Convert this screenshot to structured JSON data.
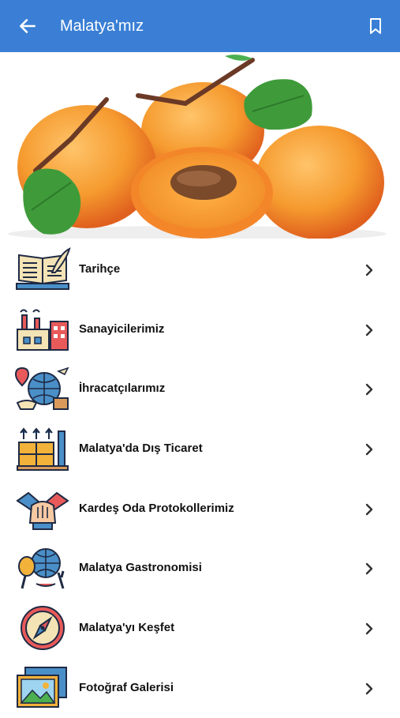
{
  "appbar": {
    "title": "Malatya'mız",
    "back_icon": "arrow-left-icon",
    "bookmark_icon": "bookmark-icon"
  },
  "hero": {
    "image": "apricots-photo"
  },
  "menu": [
    {
      "label": "Tarihçe",
      "icon": "history-book-icon"
    },
    {
      "label": "Sanayicilerimiz",
      "icon": "factory-icon"
    },
    {
      "label": "İhracatçılarımız",
      "icon": "export-globe-icon"
    },
    {
      "label": "Malatya'da Dış Ticaret",
      "icon": "trade-boxes-icon"
    },
    {
      "label": "Kardeş Oda Protokollerimiz",
      "icon": "handshake-icon"
    },
    {
      "label": "Malatya Gastronomisi",
      "icon": "gastronomy-icon"
    },
    {
      "label": "Malatya'yı Keşfet",
      "icon": "compass-icon"
    },
    {
      "label": "Fotoğraf Galerisi",
      "icon": "photo-gallery-icon"
    }
  ],
  "colors": {
    "appbar": "#3a7fd5",
    "apricot": "#f7a53a"
  }
}
